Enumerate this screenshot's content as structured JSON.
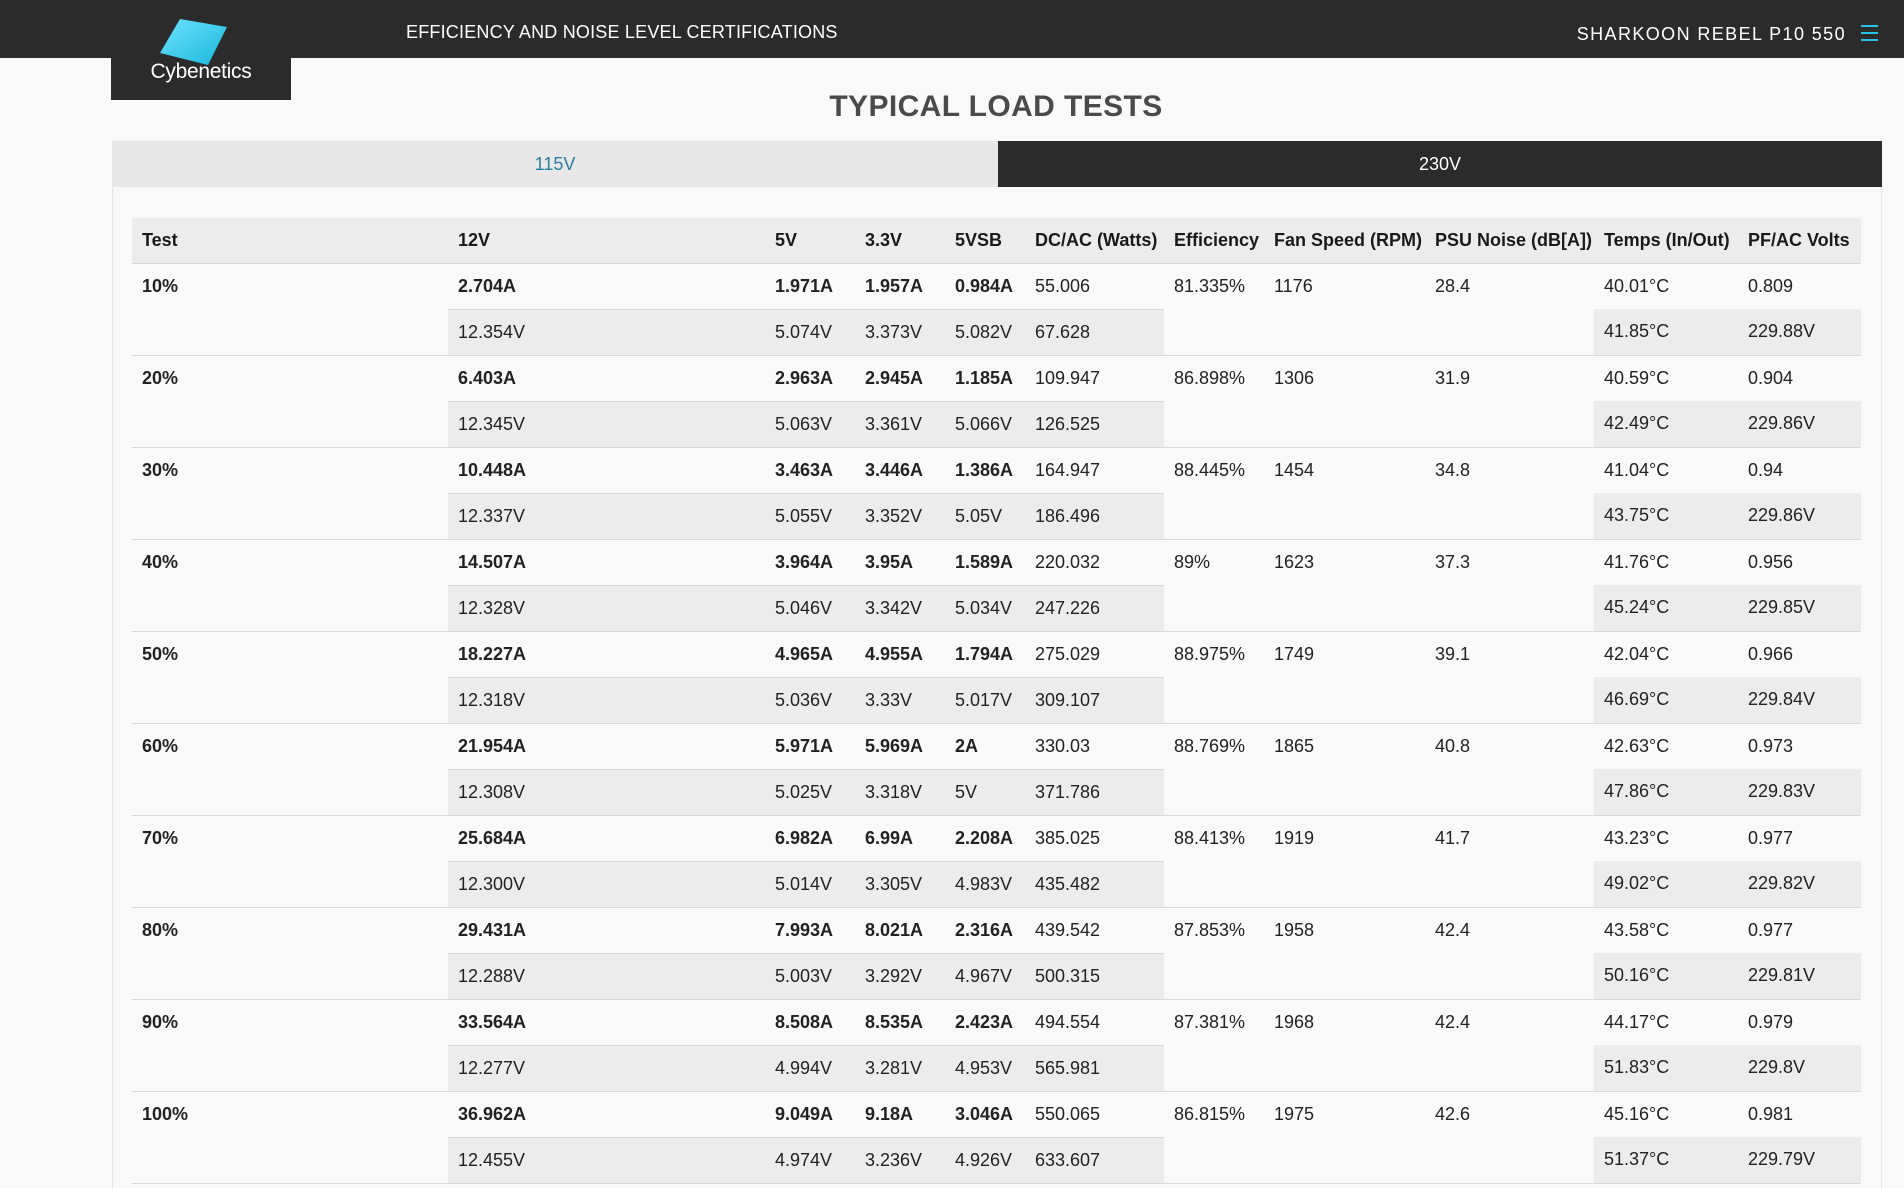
{
  "header": {
    "logo_text": "Cybenetics",
    "nav_title": "EFFICIENCY AND NOISE LEVEL CERTIFICATIONS",
    "product_name": "SHARKOON REBEL P10 550",
    "accent_color": "#27c3e6",
    "bar_color": "#2b2b2b"
  },
  "section_title": "TYPICAL LOAD TESTS",
  "tabs": [
    {
      "label": "115V",
      "active": false
    },
    {
      "label": "230V",
      "active": true
    }
  ],
  "table": {
    "columns": [
      "Test",
      "12V",
      "5V",
      "3.3V",
      "5VSB",
      "DC/AC (Watts)",
      "Efficiency",
      "Fan Speed (RPM)",
      "PSU Noise (dB[A])",
      "Temps (In/Out)",
      "PF/AC Volts"
    ],
    "rows": [
      {
        "test": "10%",
        "a12": "2.704A",
        "a5": "1.971A",
        "a33": "1.957A",
        "a5sb": "0.984A",
        "dc": "55.006",
        "eff": "81.335%",
        "fan": "1176",
        "noise": "28.4",
        "temp_in": "40.01°C",
        "pf": "0.809",
        "v12": "12.354V",
        "v5": "5.074V",
        "v33": "3.373V",
        "v5sb": "5.082V",
        "ac": "67.628",
        "temp_out": "41.85°C",
        "ac_volts": "229.88V"
      },
      {
        "test": "20%",
        "a12": "6.403A",
        "a5": "2.963A",
        "a33": "2.945A",
        "a5sb": "1.185A",
        "dc": "109.947",
        "eff": "86.898%",
        "fan": "1306",
        "noise": "31.9",
        "temp_in": "40.59°C",
        "pf": "0.904",
        "v12": "12.345V",
        "v5": "5.063V",
        "v33": "3.361V",
        "v5sb": "5.066V",
        "ac": "126.525",
        "temp_out": "42.49°C",
        "ac_volts": "229.86V"
      },
      {
        "test": "30%",
        "a12": "10.448A",
        "a5": "3.463A",
        "a33": "3.446A",
        "a5sb": "1.386A",
        "dc": "164.947",
        "eff": "88.445%",
        "fan": "1454",
        "noise": "34.8",
        "temp_in": "41.04°C",
        "pf": "0.94",
        "v12": "12.337V",
        "v5": "5.055V",
        "v33": "3.352V",
        "v5sb": "5.05V",
        "ac": "186.496",
        "temp_out": "43.75°C",
        "ac_volts": "229.86V"
      },
      {
        "test": "40%",
        "a12": "14.507A",
        "a5": "3.964A",
        "a33": "3.95A",
        "a5sb": "1.589A",
        "dc": "220.032",
        "eff": "89%",
        "fan": "1623",
        "noise": "37.3",
        "temp_in": "41.76°C",
        "pf": "0.956",
        "v12": "12.328V",
        "v5": "5.046V",
        "v33": "3.342V",
        "v5sb": "5.034V",
        "ac": "247.226",
        "temp_out": "45.24°C",
        "ac_volts": "229.85V"
      },
      {
        "test": "50%",
        "a12": "18.227A",
        "a5": "4.965A",
        "a33": "4.955A",
        "a5sb": "1.794A",
        "dc": "275.029",
        "eff": "88.975%",
        "fan": "1749",
        "noise": "39.1",
        "temp_in": "42.04°C",
        "pf": "0.966",
        "v12": "12.318V",
        "v5": "5.036V",
        "v33": "3.33V",
        "v5sb": "5.017V",
        "ac": "309.107",
        "temp_out": "46.69°C",
        "ac_volts": "229.84V"
      },
      {
        "test": "60%",
        "a12": "21.954A",
        "a5": "5.971A",
        "a33": "5.969A",
        "a5sb": "2A",
        "dc": "330.03",
        "eff": "88.769%",
        "fan": "1865",
        "noise": "40.8",
        "temp_in": "42.63°C",
        "pf": "0.973",
        "v12": "12.308V",
        "v5": "5.025V",
        "v33": "3.318V",
        "v5sb": "5V",
        "ac": "371.786",
        "temp_out": "47.86°C",
        "ac_volts": "229.83V"
      },
      {
        "test": "70%",
        "a12": "25.684A",
        "a5": "6.982A",
        "a33": "6.99A",
        "a5sb": "2.208A",
        "dc": "385.025",
        "eff": "88.413%",
        "fan": "1919",
        "noise": "41.7",
        "temp_in": "43.23°C",
        "pf": "0.977",
        "v12": "12.300V",
        "v5": "5.014V",
        "v33": "3.305V",
        "v5sb": "4.983V",
        "ac": "435.482",
        "temp_out": "49.02°C",
        "ac_volts": "229.82V"
      },
      {
        "test": "80%",
        "a12": "29.431A",
        "a5": "7.993A",
        "a33": "8.021A",
        "a5sb": "2.316A",
        "dc": "439.542",
        "eff": "87.853%",
        "fan": "1958",
        "noise": "42.4",
        "temp_in": "43.58°C",
        "pf": "0.977",
        "v12": "12.288V",
        "v5": "5.003V",
        "v33": "3.292V",
        "v5sb": "4.967V",
        "ac": "500.315",
        "temp_out": "50.16°C",
        "ac_volts": "229.81V"
      },
      {
        "test": "90%",
        "a12": "33.564A",
        "a5": "8.508A",
        "a33": "8.535A",
        "a5sb": "2.423A",
        "dc": "494.554",
        "eff": "87.381%",
        "fan": "1968",
        "noise": "42.4",
        "temp_in": "44.17°C",
        "pf": "0.979",
        "v12": "12.277V",
        "v5": "4.994V",
        "v33": "3.281V",
        "v5sb": "4.953V",
        "ac": "565.981",
        "temp_out": "51.83°C",
        "ac_volts": "229.8V"
      },
      {
        "test": "100%",
        "a12": "36.962A",
        "a5": "9.049A",
        "a33": "9.18A",
        "a5sb": "3.046A",
        "dc": "550.065",
        "eff": "86.815%",
        "fan": "1975",
        "noise": "42.6",
        "temp_in": "45.16°C",
        "pf": "0.981",
        "v12": "12.455V",
        "v5": "4.974V",
        "v33": "3.236V",
        "v5sb": "4.926V",
        "ac": "633.607",
        "temp_out": "51.37°C",
        "ac_volts": "229.79V"
      }
    ]
  }
}
